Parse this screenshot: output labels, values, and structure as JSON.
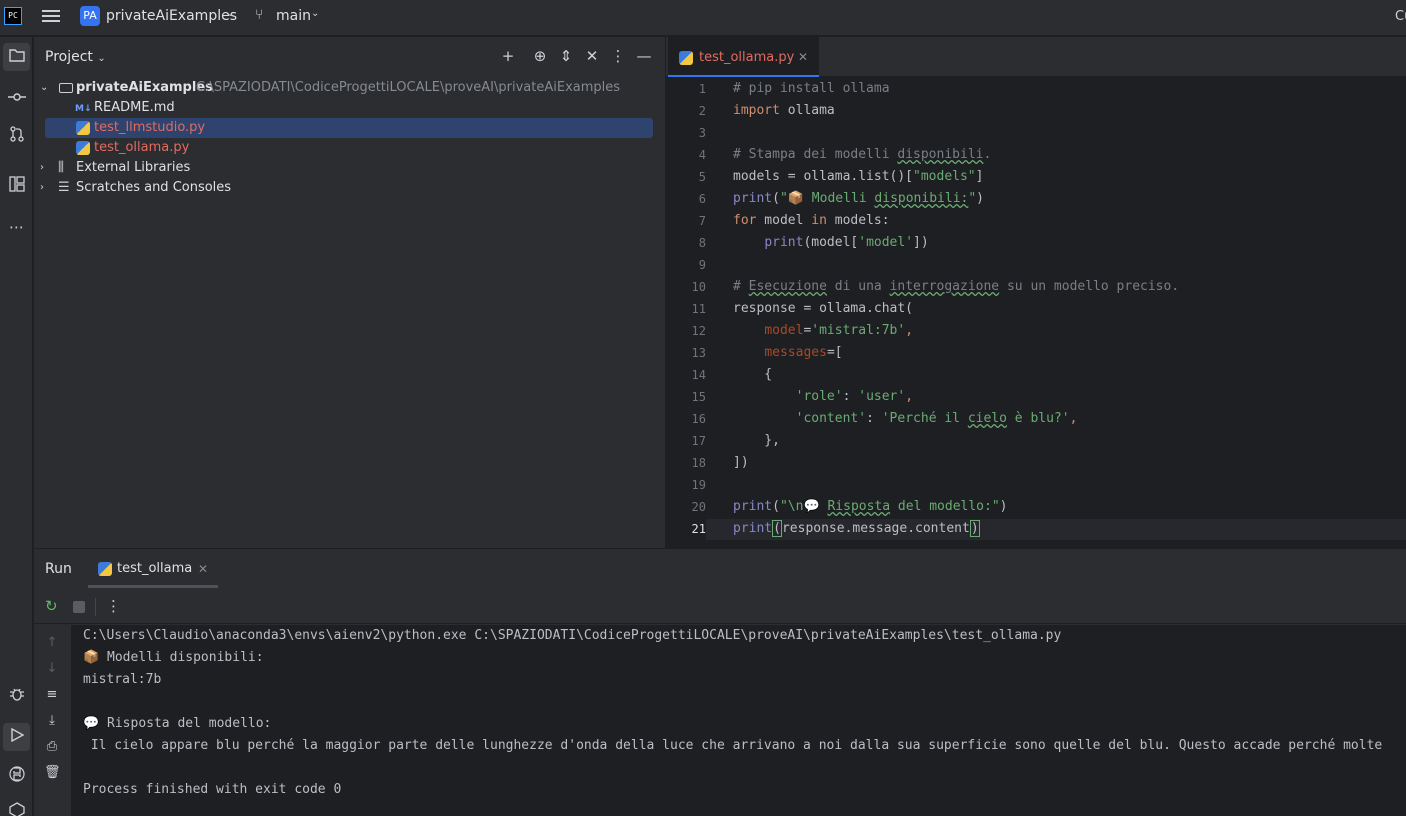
{
  "titlebar": {
    "logo_text": "PC",
    "project_badge": "PA",
    "project_name": "privateAiExamples",
    "branch": "main",
    "cut_text": "Cu"
  },
  "project_panel": {
    "title": "Project",
    "tree": [
      {
        "label": "privateAiExamples",
        "path": "C:\\SPAZIODATI\\CodiceProgettiLOCALE\\proveAI\\privateAiExamples"
      },
      {
        "label": "README.md",
        "icon": "M↓"
      },
      {
        "label": "test_llmstudio.py"
      },
      {
        "label": "test_ollama.py"
      },
      {
        "label": "External Libraries"
      },
      {
        "label": "Scratches and Consoles"
      }
    ]
  },
  "editor": {
    "tab_label": "test_ollama.py",
    "line_numbers": [
      "1",
      "2",
      "3",
      "4",
      "5",
      "6",
      "7",
      "8",
      "9",
      "10",
      "11",
      "12",
      "13",
      "14",
      "15",
      "16",
      "17",
      "18",
      "19",
      "20",
      "21"
    ],
    "code": {
      "l1": "# pip install ollama",
      "l2a": "import",
      "l2b": " ollama",
      "l4a": "# Stampa dei modelli ",
      "l4b": "disponibili",
      "l4c": ".",
      "l5a": "models = ollama.list()[",
      "l5b": "\"models\"",
      "l5c": "]",
      "l6a": "print",
      "l6b": "(",
      "l6c": "\"📦 Modelli ",
      "l6d": "disponibili:",
      "l6e": "\"",
      "l6f": ")",
      "l7a": "for",
      "l7b": " model ",
      "l7c": "in",
      "l7d": " models:",
      "l8a": "    ",
      "l8b": "print",
      "l8c": "(model[",
      "l8d": "'model'",
      "l8e": "])",
      "l10a": "# ",
      "l10b": "Esecuzione",
      "l10c": " di una ",
      "l10d": "interrogazione",
      "l10e": " su un modello preciso.",
      "l11": "response = ollama.chat(",
      "l12a": "    ",
      "l12b": "model",
      "l12c": "=",
      "l12d": "'mistral:7b'",
      "l12e": ",",
      "l13a": "    ",
      "l13b": "messages",
      "l13c": "=[",
      "l14": "    {",
      "l15a": "        ",
      "l15b": "'role'",
      "l15c": ": ",
      "l15d": "'user'",
      "l15e": ",",
      "l16a": "        ",
      "l16b": "'content'",
      "l16c": ": ",
      "l16d": "'Perché il ",
      "l16e": "cielo",
      "l16f": " è blu?'",
      "l16g": ",",
      "l17a": "    },",
      "l17b": "",
      "l18": "])",
      "l20a": "print",
      "l20b": "(",
      "l20c": "\"\\n💬 ",
      "l20d": "Risposta",
      "l20e": " del modello:\"",
      "l20f": ")",
      "l21a": "print",
      "l21b": "(",
      "l21c": "response.message.content",
      "l21d": ")"
    }
  },
  "run_panel": {
    "title": "Run",
    "tab_label": "test_ollama",
    "console_lines": [
      "C:\\Users\\Claudio\\anaconda3\\envs\\aienv2\\python.exe C:\\SPAZIODATI\\CodiceProgettiLOCALE\\proveAI\\privateAiExamples\\test_ollama.py",
      "📦 Modelli disponibili:",
      "mistral:7b",
      "",
      "💬 Risposta del modello:",
      " Il cielo appare blu perché la maggior parte delle lunghezze d'onda della luce che arrivano a noi dalla sua superficie sono quelle del blu. Questo accade perché molte",
      "",
      "Process finished with exit code 0"
    ]
  },
  "colors": {
    "accent": "#3574f0",
    "modified_file": "#e06c61",
    "string": "#6aab73",
    "keyword": "#cf8e6d",
    "comment": "#7a7e85"
  }
}
